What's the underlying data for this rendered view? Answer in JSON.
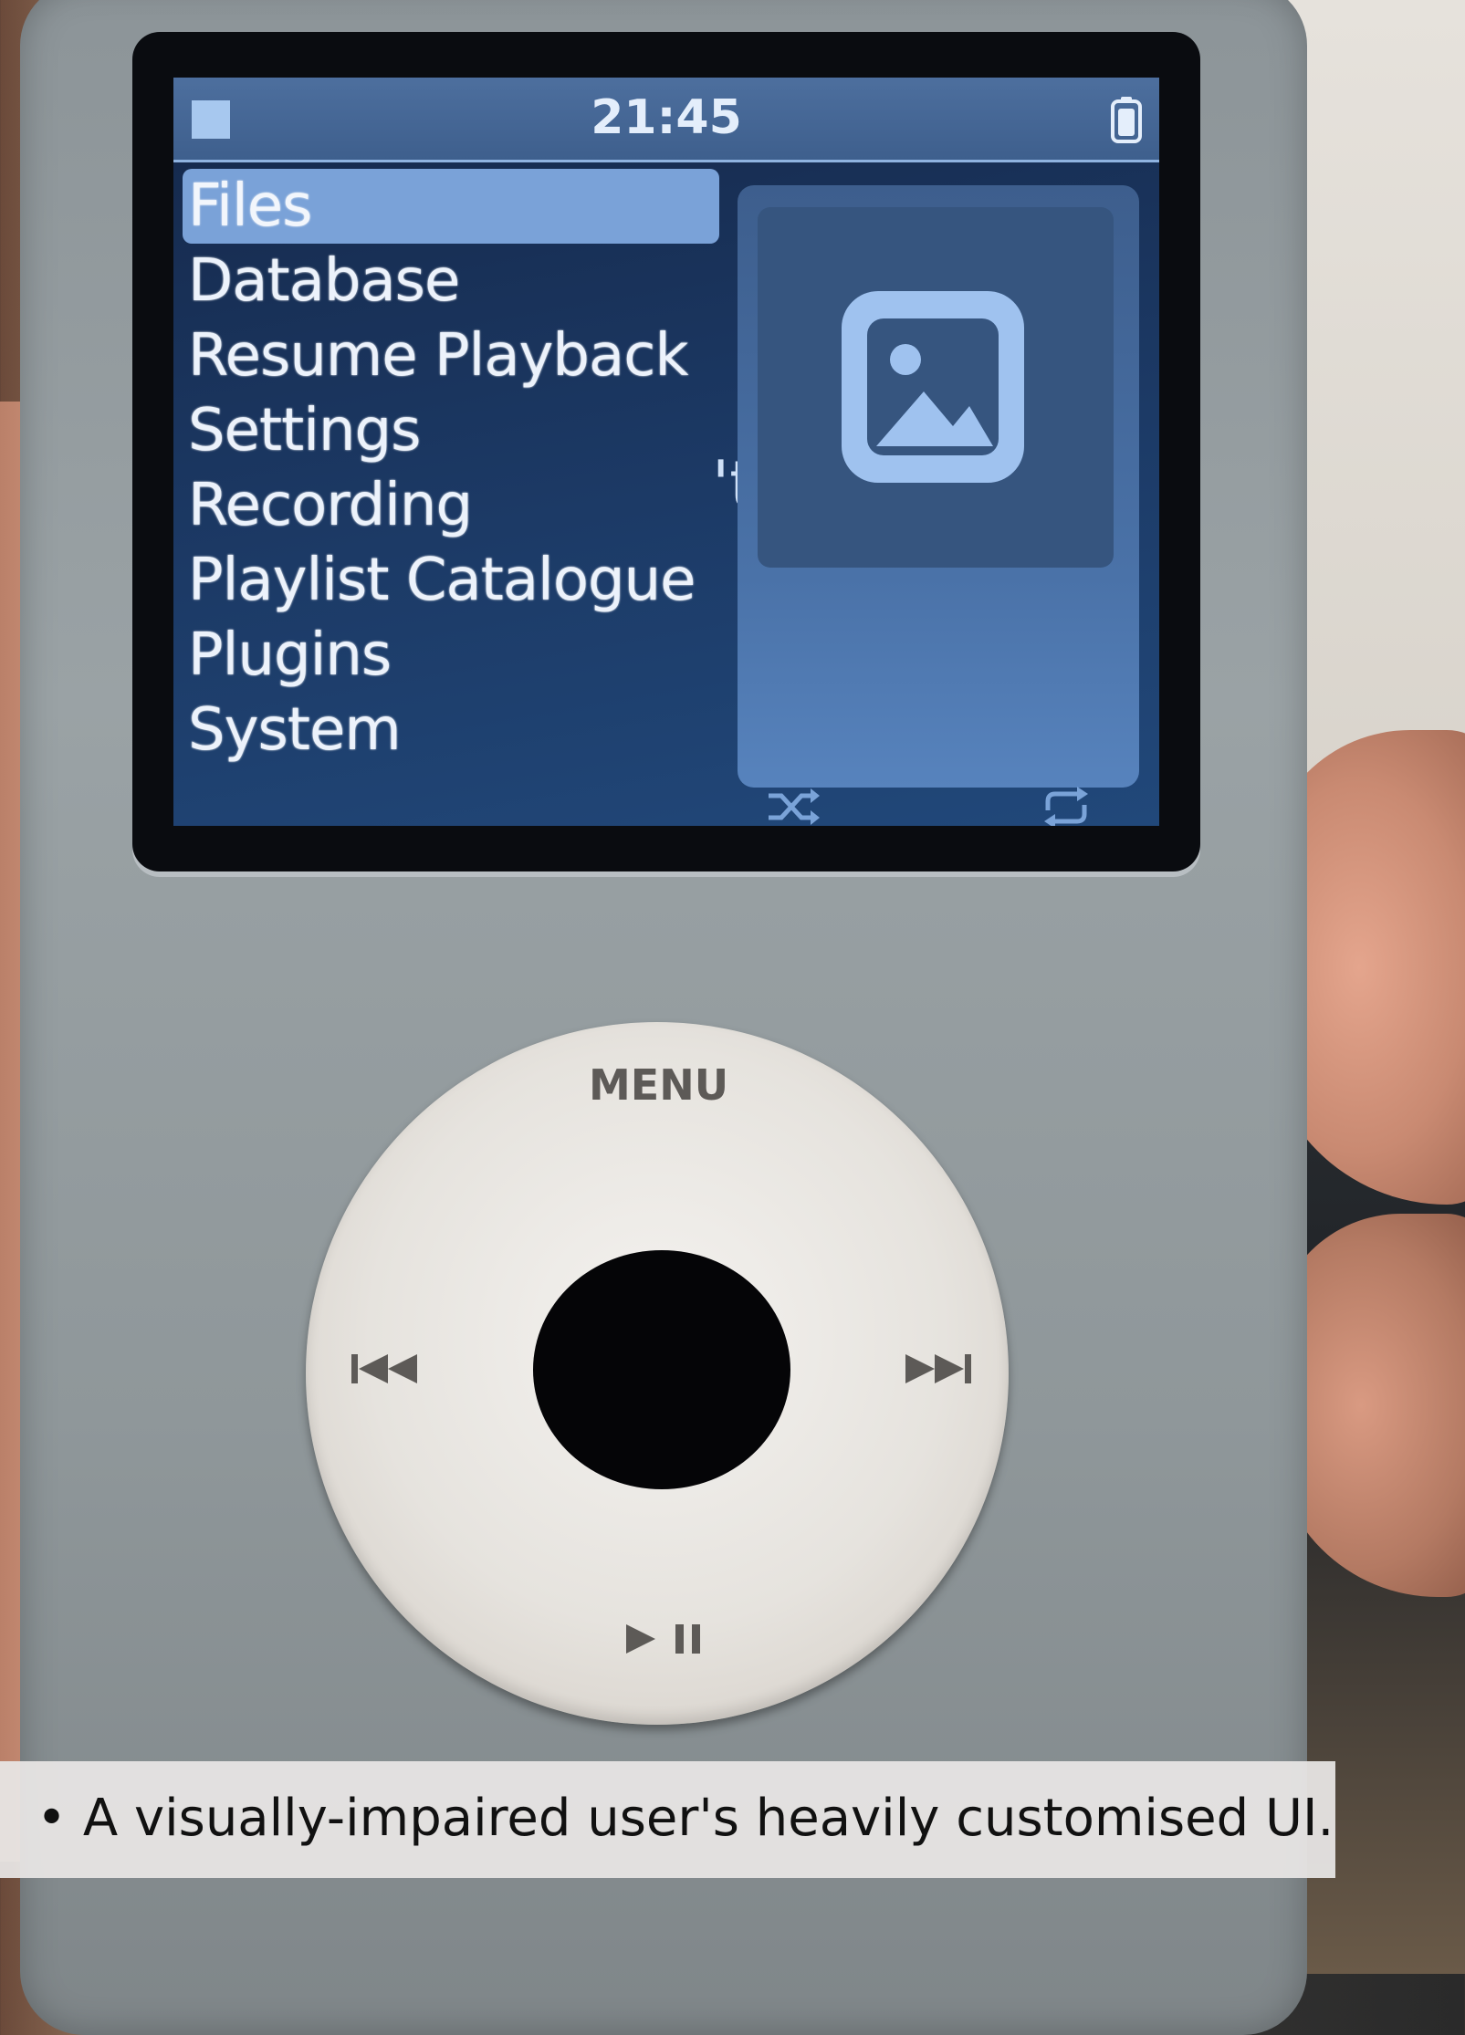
{
  "status_bar": {
    "time": "21:45",
    "left_indicator": "playback-stopped-icon",
    "right_indicator": "battery-icon"
  },
  "menu": {
    "items": [
      {
        "label": "Files",
        "selected": true
      },
      {
        "label": "Database",
        "selected": false
      },
      {
        "label": "Resume Playback",
        "selected": false
      },
      {
        "label": "Settings",
        "selected": false
      },
      {
        "label": "Recording",
        "selected": false
      },
      {
        "label": "Playlist Catalogue",
        "selected": false
      },
      {
        "label": "Plugins",
        "selected": false
      },
      {
        "label": "System",
        "selected": false
      }
    ]
  },
  "now_playing_panel": {
    "artwork": "image-placeholder-icon",
    "stray_text": "'t",
    "shuffle_icon": "shuffle-icon",
    "repeat_icon": "repeat-icon"
  },
  "click_wheel": {
    "menu_label": "MENU",
    "prev_icon": "previous-track-icon",
    "next_icon": "next-track-icon",
    "play_pause_icon": "play-pause-icon"
  },
  "caption": {
    "text": "• A visually-impaired user's heavily customised UI."
  },
  "colors": {
    "screen_bg": "#1c3a66",
    "selection": "#7aa2d8",
    "status_bar": "#4d6f9e",
    "device_body": "#9aa2a5",
    "wheel": "#e6e3de"
  }
}
